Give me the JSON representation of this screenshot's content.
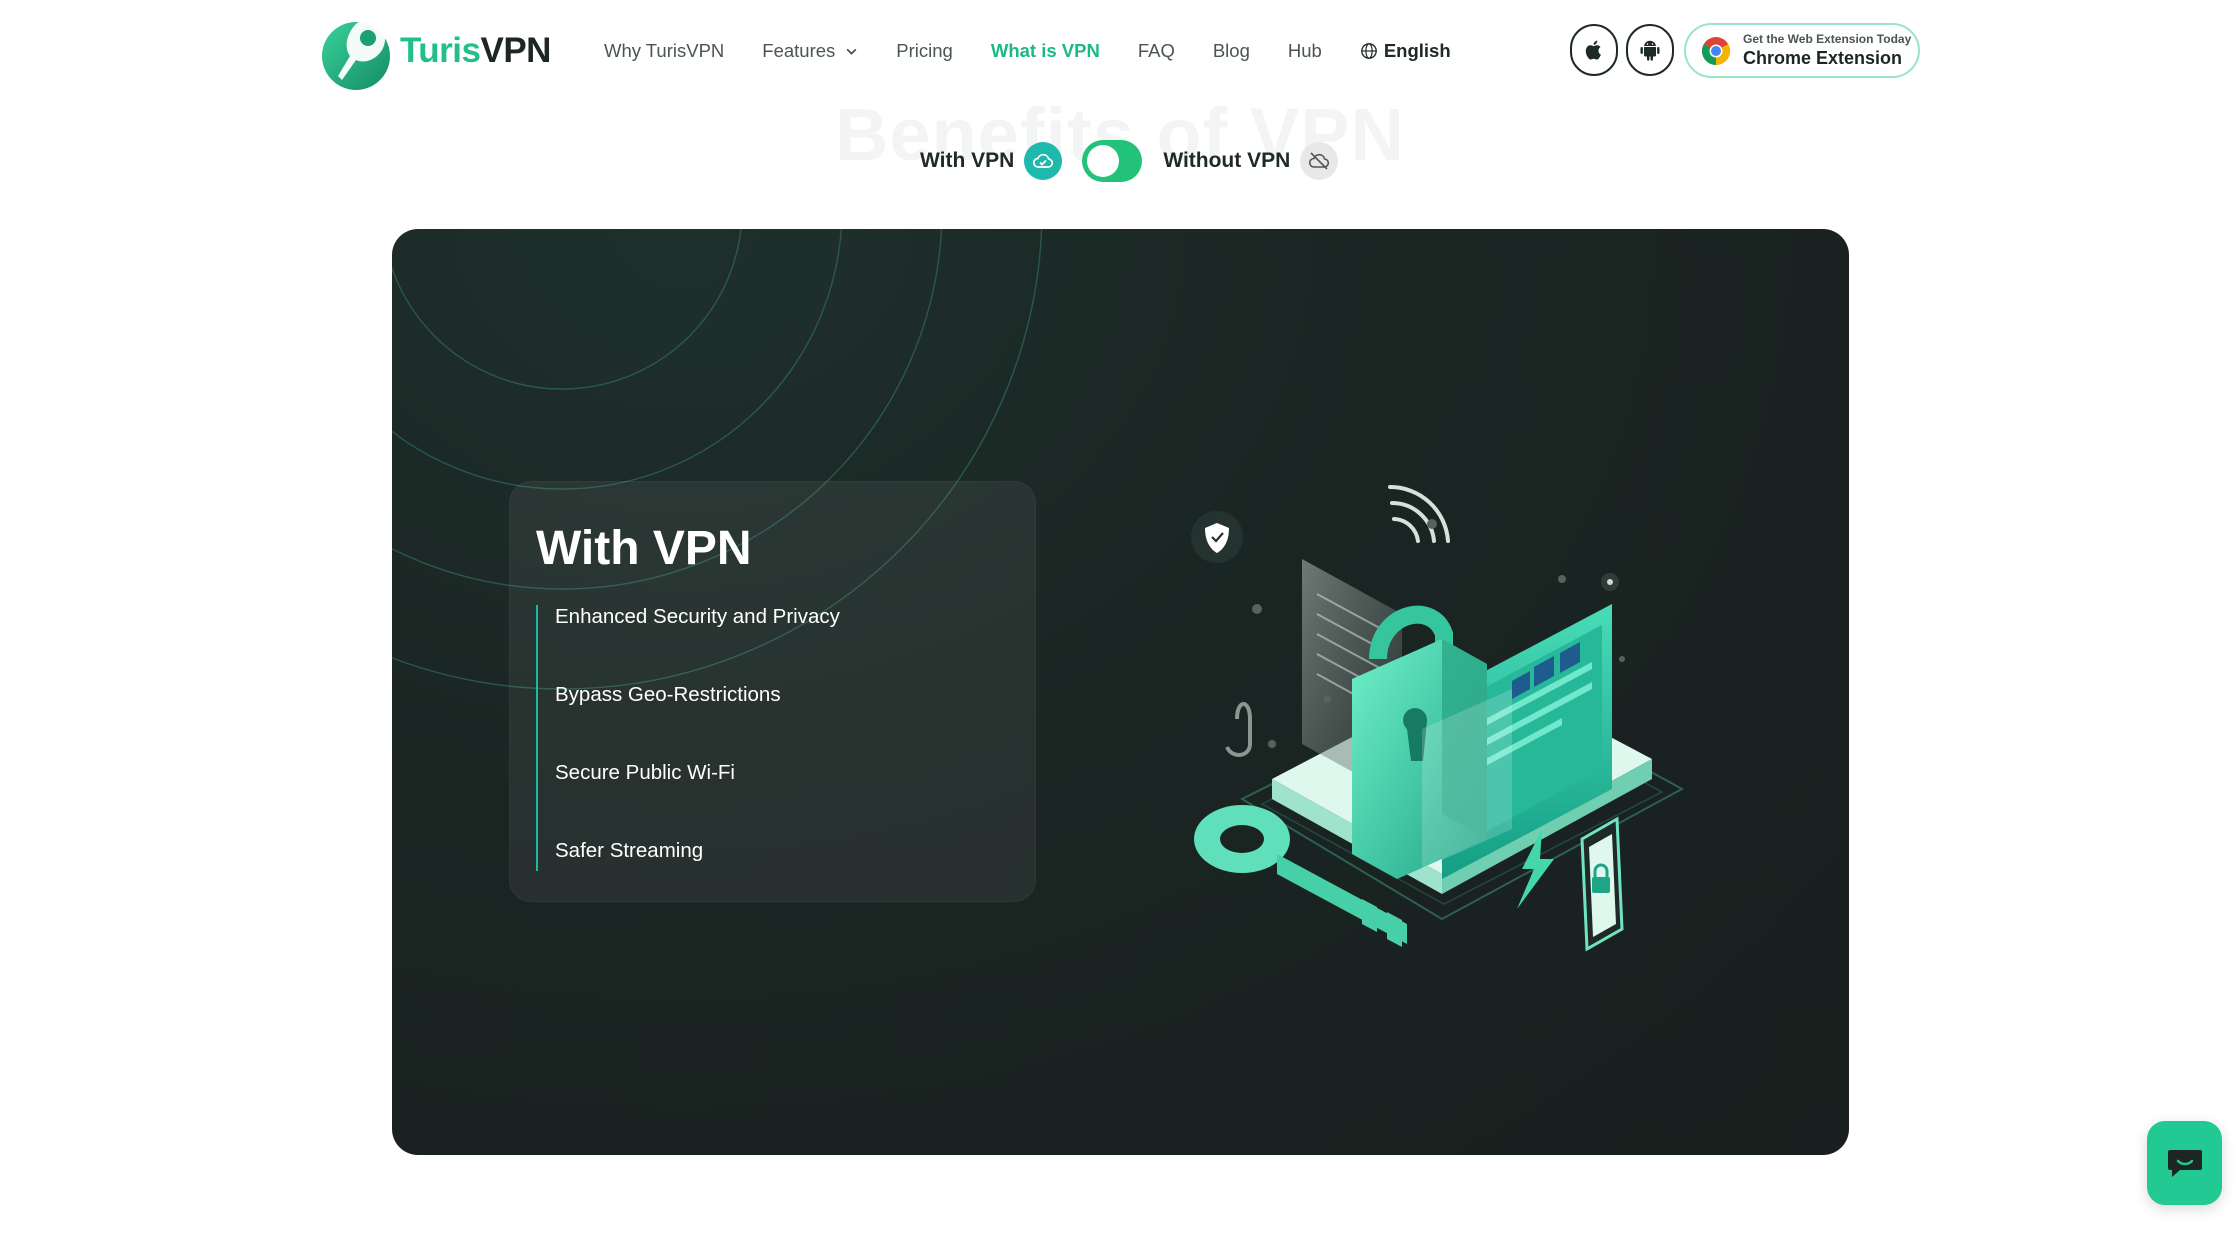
{
  "brand": {
    "name_part1": "Turis",
    "name_part2": "VPN",
    "accent": "#21c08b",
    "dark": "#1d2623"
  },
  "nav": {
    "items": [
      {
        "label": "Why TurisVPN"
      },
      {
        "label": "Features",
        "has_dropdown": true
      },
      {
        "label": "Pricing"
      },
      {
        "label": "What is VPN",
        "active": true
      },
      {
        "label": "FAQ"
      },
      {
        "label": "Blog"
      },
      {
        "label": "Hub"
      }
    ],
    "language": "English"
  },
  "header_buttons": {
    "apple_icon": "apple-icon",
    "android_icon": "android-icon",
    "extension": {
      "small_text": "Get the Web Extension Today",
      "label": "Chrome Extension",
      "icon": "chrome-icon"
    }
  },
  "section": {
    "title": "Benefits of VPN"
  },
  "toggle": {
    "with_label": "With VPN",
    "without_label": "Without VPN",
    "with_icon": "cloud-check-icon",
    "without_icon": "cloud-off-icon",
    "state": "with"
  },
  "card": {
    "title": "With VPN",
    "benefits": [
      "Enhanced Security and Privacy",
      "Bypass Geo-Restrictions",
      "Secure Public Wi-Fi",
      "Safer Streaming"
    ],
    "illustration": "vpn-security-illustration"
  },
  "chat": {
    "icon": "chat-icon",
    "color": "#22c993"
  }
}
